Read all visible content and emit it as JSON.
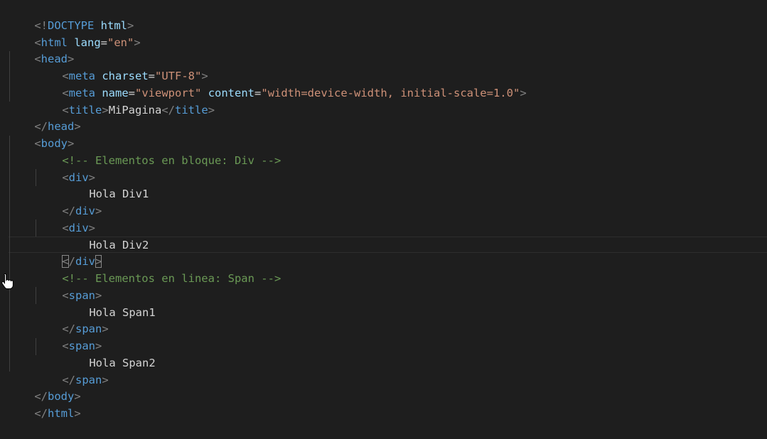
{
  "colors": {
    "background": "#1e1e1e",
    "tag_bracket": "#808080",
    "tag_name": "#569cd6",
    "attribute": "#9cdcfe",
    "string": "#ce9178",
    "text": "#d4d4d4",
    "comment": "#6a9955",
    "guide": "#404040"
  },
  "code": {
    "line1": {
      "open": "<!",
      "doctype": "DOCTYPE",
      "sp": " ",
      "html": "html",
      "close": ">"
    },
    "line2": {
      "lt": "<",
      "tag": "html",
      "sp": " ",
      "attr": "lang",
      "eq": "=",
      "val": "\"en\"",
      "gt": ">"
    },
    "line3": {
      "lt": "<",
      "tag": "head",
      "gt": ">"
    },
    "line4": {
      "lt": "<",
      "tag": "meta",
      "sp": " ",
      "attr": "charset",
      "eq": "=",
      "val": "\"UTF-8\"",
      "gt": ">"
    },
    "line5": {
      "lt": "<",
      "tag": "meta",
      "sp1": " ",
      "attr1": "name",
      "eq1": "=",
      "val1": "\"viewport\"",
      "sp2": " ",
      "attr2": "content",
      "eq2": "=",
      "val2": "\"width=device-width, initial-scale=1.0\"",
      "gt": ">"
    },
    "line6": {
      "lt": "<",
      "tag": "title",
      "gt": ">",
      "text": "MiPagina",
      "lt2": "</",
      "tag2": "title",
      "gt2": ">"
    },
    "line7": {
      "lt": "</",
      "tag": "head",
      "gt": ">"
    },
    "line8": {
      "lt": "<",
      "tag": "body",
      "gt": ">"
    },
    "line9": {
      "comment": "<!-- Elementos en bloque: Div -->"
    },
    "line10": {
      "lt": "<",
      "tag": "div",
      "gt": ">"
    },
    "line11": {
      "text": "Hola Div1"
    },
    "line12": {
      "lt": "</",
      "tag": "div",
      "gt": ">"
    },
    "line13": {
      "lt": "<",
      "tag": "div",
      "gt": ">"
    },
    "line14": {
      "text": "Hola Div2"
    },
    "line15": {
      "lt_a": "<",
      "lt_b": "/",
      "tag": "div",
      "gt": ">"
    },
    "line16": {
      "comment": "<!-- Elementos en linea: Span -->"
    },
    "line17": {
      "lt": "<",
      "tag": "span",
      "gt": ">"
    },
    "line18": {
      "text": "Hola Span1"
    },
    "line19": {
      "lt": "</",
      "tag": "span",
      "gt": ">"
    },
    "line20": {
      "lt": "<",
      "tag": "span",
      "gt": ">"
    },
    "line21": {
      "text": "Hola Span2"
    },
    "line22": {
      "lt": "</",
      "tag": "span",
      "gt": ">"
    },
    "line23": {
      "lt": "</",
      "tag": "body",
      "gt": ">"
    },
    "line24": {
      "lt": "</",
      "tag": "html",
      "gt": ">"
    }
  },
  "cursor_icon": "hand-pointer-icon"
}
